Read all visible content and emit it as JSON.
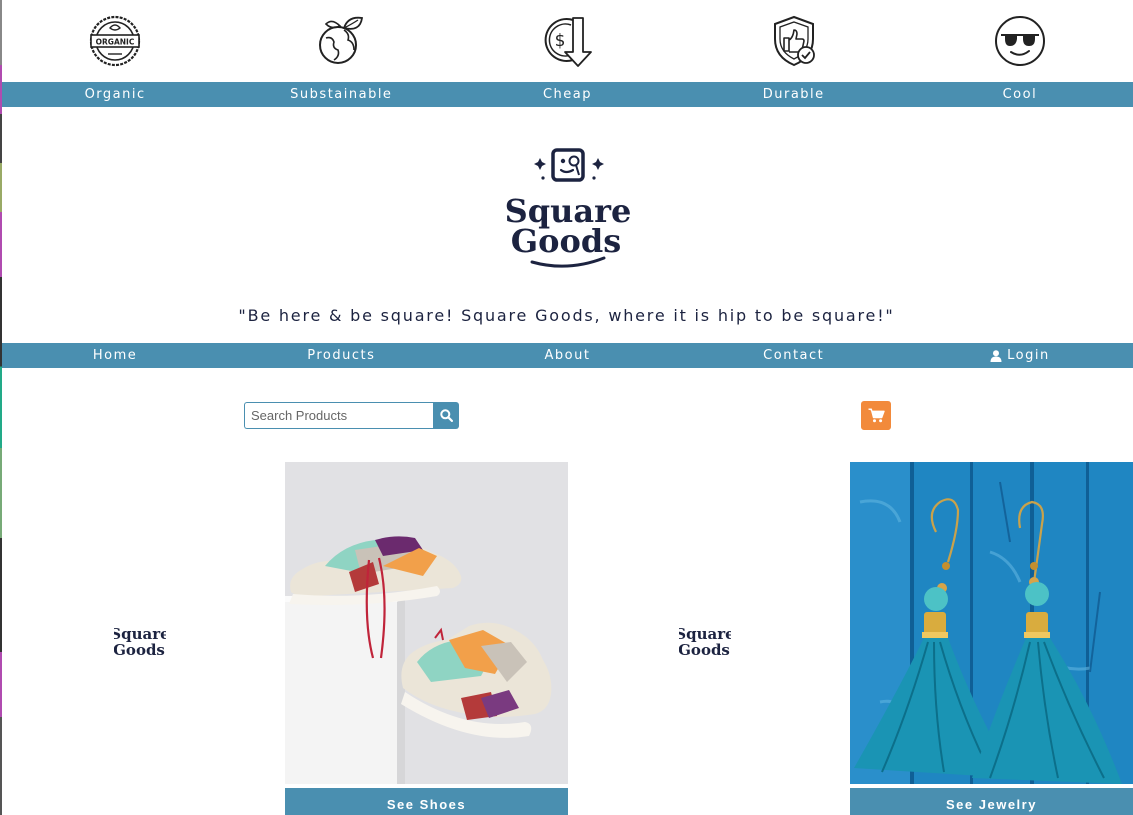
{
  "features": [
    {
      "label": "Organic",
      "icon": "organic-badge-icon"
    },
    {
      "label": "Substainable",
      "icon": "earth-leaf-icon"
    },
    {
      "label": "Cheap",
      "icon": "dollar-down-icon"
    },
    {
      "label": "Durable",
      "icon": "shield-thumb-icon"
    },
    {
      "label": "Cool",
      "icon": "sunglasses-face-icon"
    }
  ],
  "badge_text": "ORGANIC",
  "brand": {
    "line1": "Square",
    "line2": "Goods"
  },
  "tagline": "\"Be here & be square! Square Goods, where it is hip to be square!\"",
  "nav": {
    "home": "Home",
    "products": "Products",
    "about": "About",
    "contact": "Contact",
    "login": "Login"
  },
  "search": {
    "placeholder": "Search Products",
    "value": ""
  },
  "colors": {
    "accent": "#4a8fb0",
    "cart": "#f28a3b",
    "brand": "#1c2340"
  },
  "tiles": {
    "shoes": {
      "caption": "See Shoes"
    },
    "jewelry": {
      "caption": "See Jewelry"
    }
  }
}
